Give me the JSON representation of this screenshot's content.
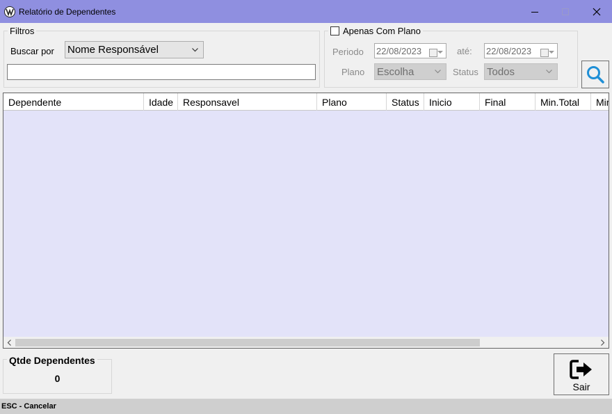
{
  "window": {
    "title": "Relatório de Dependentes",
    "icon": "app-logo-icon",
    "controls": [
      "minimize-icon",
      "maximize-icon",
      "close-icon"
    ]
  },
  "filters": {
    "legend": "Filtros",
    "search_by_label": "Buscar por",
    "search_by_value": "Nome Responsável",
    "search_text": ""
  },
  "plan_filter": {
    "checkbox_label": "Apenas Com Plano",
    "checked": false,
    "period_label": "Periodo",
    "date_from": "22/08/2023",
    "until_label": "até:",
    "date_to": "22/08/2023",
    "plan_label": "Plano",
    "plan_value": "Escolha",
    "status_label": "Status",
    "status_value": "Todos"
  },
  "search_button": {
    "icon": "search-icon"
  },
  "grid": {
    "columns": [
      "Dependente",
      "Idade",
      "Responsavel",
      "Plano",
      "Status",
      "Inicio",
      "Final",
      "Min.Total",
      "Min"
    ],
    "rows": []
  },
  "summary": {
    "title": "Qtde Dependentes",
    "count": "0"
  },
  "exit_button": {
    "label": "Sair",
    "icon": "exit-icon"
  },
  "status_bar": {
    "text": "ESC - Cancelar"
  },
  "colors": {
    "titlebar": "#8f8fe0",
    "grid_background": "#e3e3f9",
    "search_icon": "#1f8fd6"
  }
}
